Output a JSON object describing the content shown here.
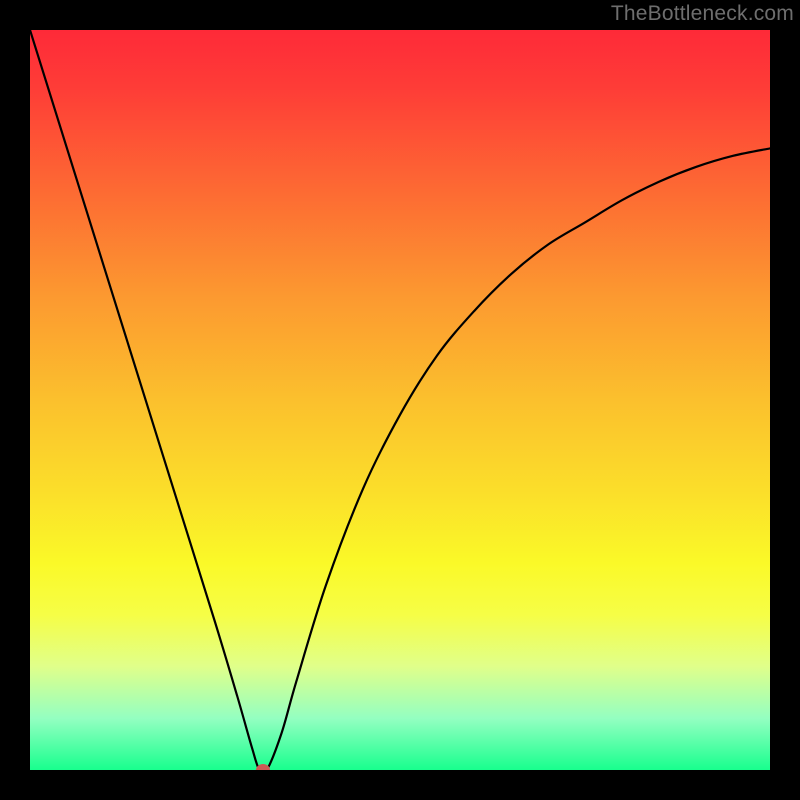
{
  "watermark": "TheBottleneck.com",
  "chart_data": {
    "type": "line",
    "title": "",
    "xlabel": "",
    "ylabel": "",
    "xlim": [
      0,
      100
    ],
    "ylim": [
      0,
      100
    ],
    "grid": false,
    "legend": false,
    "series": [
      {
        "name": "bottleneck-curve",
        "x": [
          0,
          5,
          10,
          15,
          20,
          25,
          28,
          30,
          31,
          32,
          34,
          36,
          40,
          45,
          50,
          55,
          60,
          65,
          70,
          75,
          80,
          85,
          90,
          95,
          100
        ],
        "values": [
          100,
          84,
          68,
          52,
          36,
          20,
          10,
          3,
          0,
          0,
          5,
          12,
          25,
          38,
          48,
          56,
          62,
          67,
          71,
          74,
          77,
          79.5,
          81.5,
          83,
          84
        ]
      }
    ],
    "marker": {
      "x": 31.5,
      "y": 0,
      "color": "#cd5a55"
    },
    "background_gradient": {
      "top": "#fe2a38",
      "mid": "#fbe02a",
      "bottom": "#18ff8e"
    }
  }
}
